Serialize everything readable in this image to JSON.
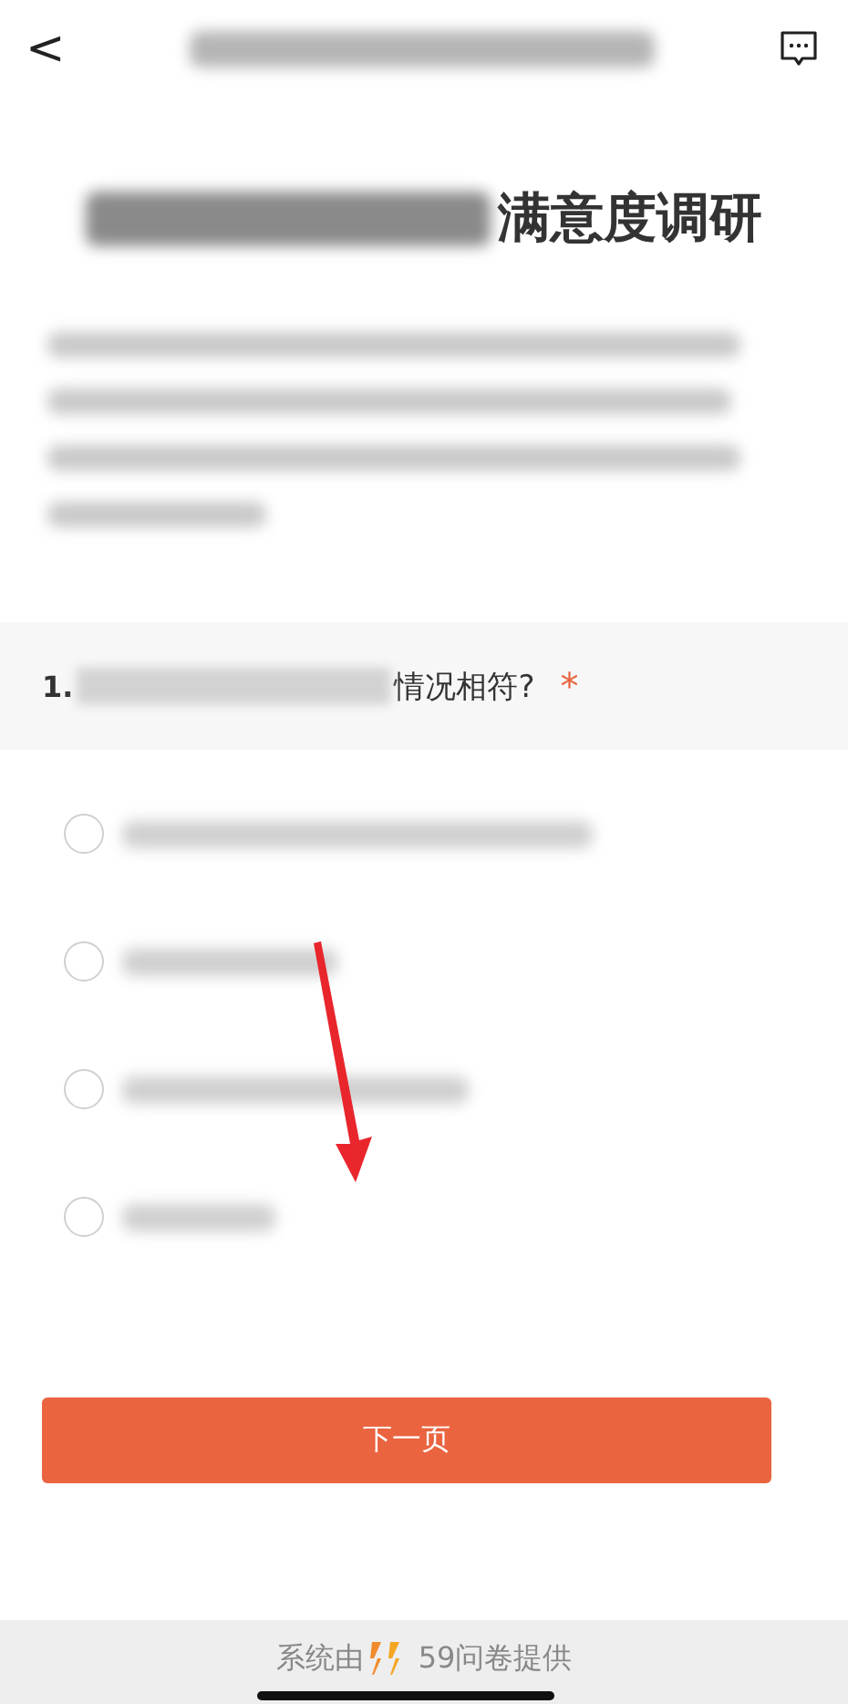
{
  "header": {
    "back": "<"
  },
  "survey": {
    "title_visible": "满意度调研"
  },
  "question": {
    "number": "1.",
    "text_visible": "情况相符?",
    "required_mark": "*",
    "options": [
      {
        "selected": false
      },
      {
        "selected": false
      },
      {
        "selected": false
      },
      {
        "selected": false
      }
    ]
  },
  "next_button": "下一页",
  "footer": {
    "prefix": "系统由",
    "suffix": "59问卷提供"
  }
}
